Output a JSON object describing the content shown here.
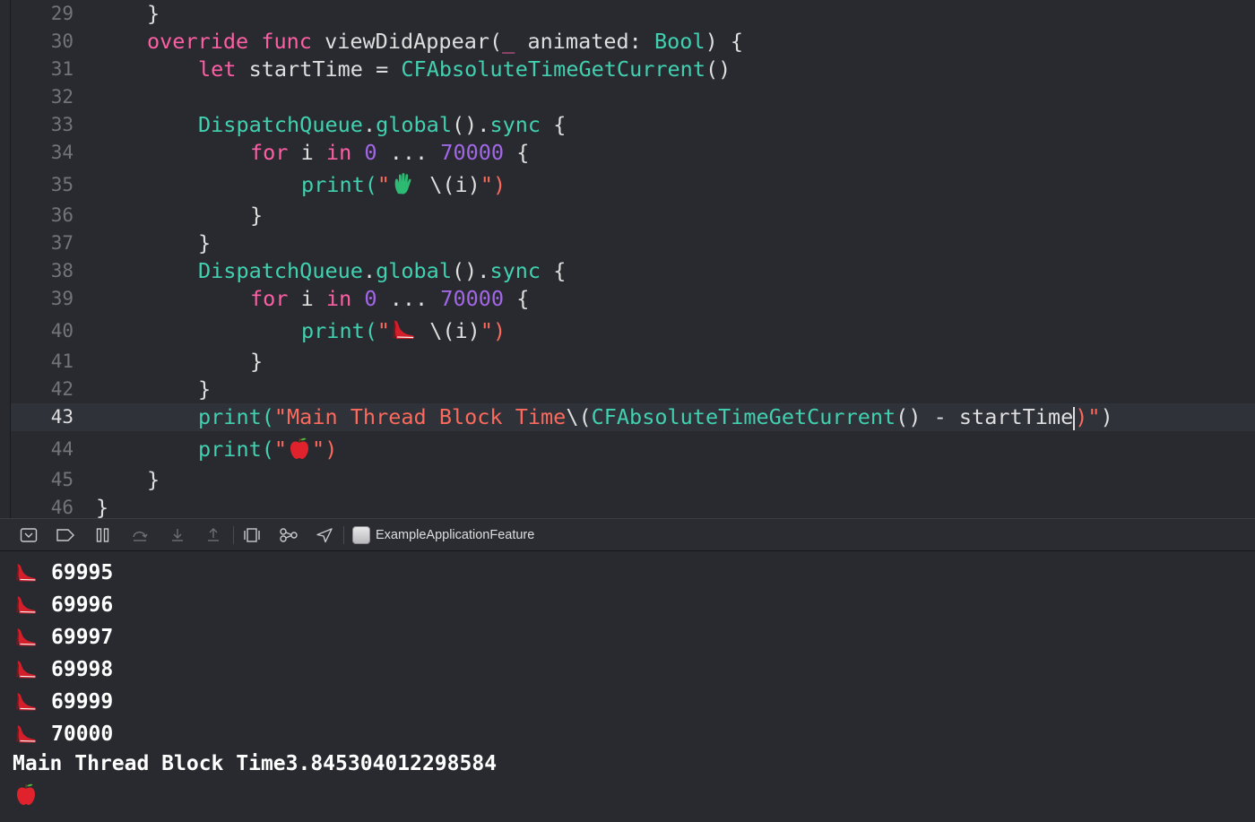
{
  "editor": {
    "lines": [
      {
        "n": "29"
      },
      {
        "n": "30"
      },
      {
        "n": "31"
      },
      {
        "n": "32"
      },
      {
        "n": "33"
      },
      {
        "n": "34"
      },
      {
        "n": "35"
      },
      {
        "n": "36"
      },
      {
        "n": "37"
      },
      {
        "n": "38"
      },
      {
        "n": "39"
      },
      {
        "n": "40"
      },
      {
        "n": "41"
      },
      {
        "n": "42"
      },
      {
        "n": "43"
      },
      {
        "n": "44"
      },
      {
        "n": "45"
      },
      {
        "n": "46"
      }
    ],
    "current_line": "43",
    "tokens": {
      "l29_brace": "}",
      "l30_override": "override",
      "l30_func": "func",
      "l30_name": "viewDidAppear(",
      "l30_under": "_",
      "l30_param": "animated:",
      "l30_type": "Bool",
      "l30_end": ") {",
      "l31_let": "let",
      "l31_var": "startTime =",
      "l31_call": "CFAbsoluteTimeGetCurrent",
      "l31_paren": "()",
      "l33_type": "DispatchQueue",
      "l33_dot": ".",
      "l33_global": "global",
      "l33_paren": "().",
      "l33_sync": "sync",
      "l33_brace": "{",
      "l34_for": "for",
      "l34_i": "i",
      "l34_in": "in",
      "l34_zero": "0",
      "l34_dots": "...",
      "l34_limit": "70000",
      "l34_brace": "{",
      "l35_print": "print(",
      "l35_q1": "\"",
      "l35_interp": "\\(",
      "l35_i": "i",
      "l35_close": ")",
      "l35_q2": "\")",
      "l36_brace": "}",
      "l37_brace": "}",
      "l38_type": "DispatchQueue",
      "l38_dot": ".",
      "l38_global": "global",
      "l38_paren": "().",
      "l38_sync": "sync",
      "l38_brace": "{",
      "l39_for": "for",
      "l39_i": "i",
      "l39_in": "in",
      "l39_zero": "0",
      "l39_dots": "...",
      "l39_limit": "70000",
      "l39_brace": "{",
      "l40_print": "print(",
      "l40_q1": "\"",
      "l40_interp": "\\(",
      "l40_i": "i",
      "l40_close": ")",
      "l40_q2": "\")",
      "l41_brace": "}",
      "l42_brace": "}",
      "l43_print": "print(",
      "l43_str": "\"Main Thread Block Time",
      "l43_interp": "\\(",
      "l43_call": "CFAbsoluteTimeGetCurrent",
      "l43_mid": "() - startTime",
      "l43_close": ")",
      "l43_q": "\"",
      "l43_end": ")",
      "l44_print": "print(",
      "l44_q1": "\"",
      "l44_q2": "\")",
      "l45_brace": "}",
      "l46_brace": "}"
    }
  },
  "debug_bar": {
    "target_name": "ExampleApplicationFeature",
    "icons": [
      "hide-debug-area-icon",
      "breakpoints-toggle-icon",
      "pause-icon",
      "step-over-icon",
      "step-into-icon",
      "step-out-icon",
      "view-debugger-icon",
      "memory-graph-icon",
      "location-icon"
    ]
  },
  "console": {
    "lines": [
      {
        "emoji": "high-heel-icon",
        "text": "69995"
      },
      {
        "emoji": "high-heel-icon",
        "text": "69996"
      },
      {
        "emoji": "high-heel-icon",
        "text": "69997"
      },
      {
        "emoji": "high-heel-icon",
        "text": "69998"
      },
      {
        "emoji": "high-heel-icon",
        "text": "69999"
      },
      {
        "emoji": "high-heel-icon",
        "text": "70000"
      }
    ],
    "main_thread": "Main Thread Block Time3.845304012298584",
    "last_emoji": "red-apple-icon"
  },
  "colors": {
    "editor_bg": "#292a30",
    "keyword": "#fc5fa3",
    "type": "#5dd8ff",
    "string": "#fc6a5d",
    "number": "#a167e6",
    "plain": "#dfdfe0",
    "current_line_bg": "#2f3239"
  }
}
